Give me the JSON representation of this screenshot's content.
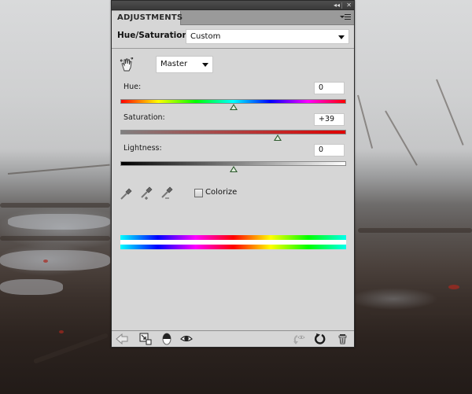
{
  "panel": {
    "tab_label": "ADJUSTMENTS",
    "titlebar": {
      "collapse_icon": "double-chevron-left-icon",
      "collapse_glyph": "◂◂",
      "close_icon": "close-icon",
      "close_glyph": "✕"
    },
    "menu_icon": "panel-menu-icon"
  },
  "adjustment": {
    "title": "Hue/Saturation",
    "preset": {
      "selected": "Custom"
    },
    "channel": {
      "selected": "Master"
    },
    "sliders": [
      {
        "label": "Hue:",
        "value": "0",
        "min": -180,
        "max": 180,
        "current": 0
      },
      {
        "label": "Saturation:",
        "value": "+39",
        "min": -100,
        "max": 100,
        "current": 39
      },
      {
        "label": "Lightness:",
        "value": "0",
        "min": -100,
        "max": 100,
        "current": 0
      }
    ],
    "colorize": {
      "label": "Colorize",
      "checked": false
    },
    "eyedroppers": [
      "eyedropper-icon",
      "eyedropper-add-icon",
      "eyedropper-subtract-icon"
    ]
  },
  "footer": {
    "left_icons": [
      "back-arrow-icon",
      "clip-to-layer-icon",
      "layer-visibility-mask-icon",
      "eye-icon"
    ],
    "right_icons": [
      "previous-state-icon",
      "reset-icon",
      "trash-icon"
    ]
  },
  "colors": {
    "panel_bg": "#d6d6d6",
    "titlebar_bg": "#3a3a3a",
    "tabrow_bg": "#9a9a9a",
    "thumb": "#2e5a2e"
  }
}
